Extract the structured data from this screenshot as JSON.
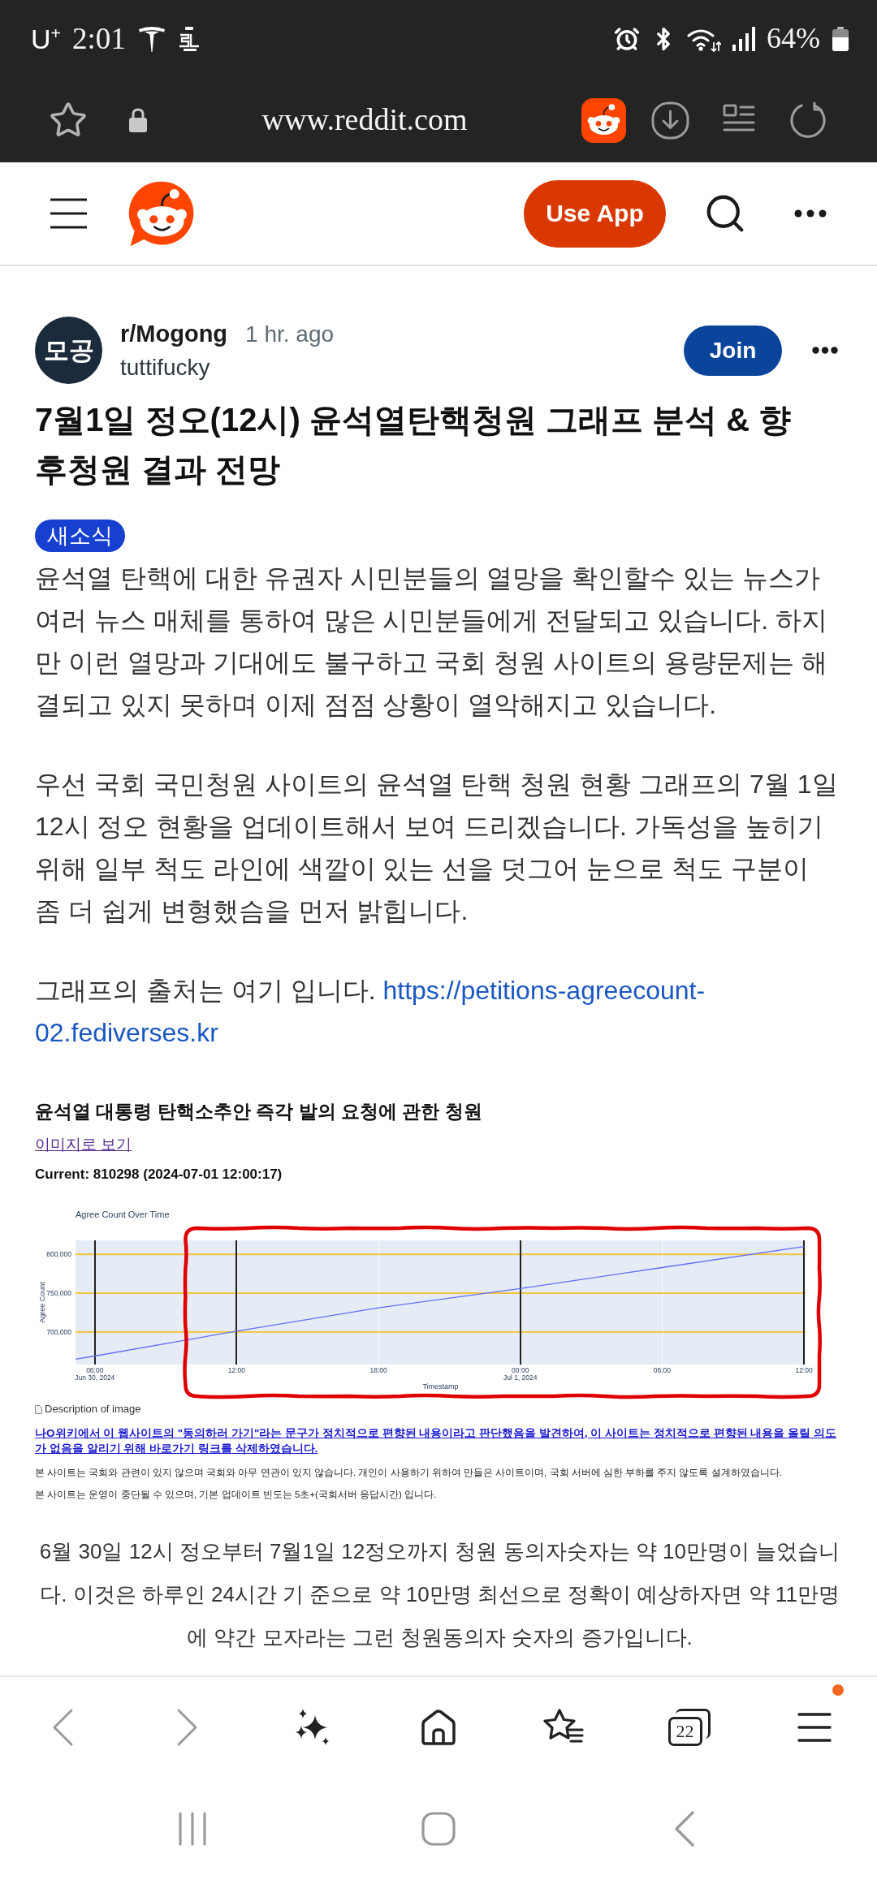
{
  "status_bar": {
    "carrier": "U$^{+}$",
    "time": "2:01",
    "battery": "64%"
  },
  "browser_bar": {
    "url": "www.reddit.com"
  },
  "site_header": {
    "use_app": "Use App"
  },
  "post": {
    "avatar": "모공",
    "subreddit": "r/Mogong",
    "age": "1 hr. ago",
    "author": "tuttifucky",
    "join": "Join",
    "title": "7월1일 정오(12시) 윤석열탄핵청원 그래프 분석 & 향후청원 결과 전망",
    "flair": "새소식",
    "paragraphs": [
      "윤석열 탄핵에 대한 유권자 시민분들의 열망을 확인할수 있는 뉴스가 여러 뉴스 매체를 통하여 많은 시민분들에게 전달되고 있습니다. 하지만 이런 열망과 기대에도 불구하고 국회 청원 사이트의 용량문제는 해결되고 있지 못하며 이제 점점 상황이 열악해지고 있습니다.",
      "우선 국회 국민청원 사이트의 윤석열 탄핵 청원 현황 그래프의 7월 1일 12시 정오 현황을 업데이트해서 보여 드리겠습니다. 가독성을 높히기 위해 일부 척도 라인에 색깔이 있는 선을 덧그어 눈으로 척도 구분이 좀 더 쉽게 변형했슴을 먼저 밝힙니다."
    ],
    "source": {
      "text": "그래프의 출처는 여기 입니다.",
      "link_lines": [
        "https://petitions-agreecount-",
        "02.fediverses.kr"
      ]
    },
    "screenshot": {
      "title": "윤석열 대통령 탄핵소추안 즉각 발의 요청에 관한 청원",
      "image_link": "이미지로 보기",
      "current": "Current: 810298 (2024-07-01 12:00:17)",
      "chart_data": {
        "type": "line",
        "title": "Agree Count Over Time",
        "xlabel": "Timestamp",
        "ylabel": "Agree Count",
        "x": [
          "2024-06-30T05:11",
          "2024-06-30T06:00",
          "2024-06-30T12:00",
          "2024-06-30T18:00",
          "2024-07-01T00:00",
          "2024-07-01T06:00",
          "2024-07-01T12:00"
        ],
        "series": [
          {
            "color": "#636efa",
            "values": [
              665000,
              669000,
              701000,
              731000,
              756000,
              783000,
              810000
            ]
          }
        ],
        "xlim": [
          "2024-06-30T05:11",
          "2024-07-01T12:04"
        ],
        "ylim": [
          658000,
          818000
        ],
        "xticks": [
          {
            "value": "2024-06-30T06:00",
            "label": "06:00\nJun 30, 2024"
          },
          {
            "value": "2024-06-30T12:00",
            "label": "12:00"
          },
          {
            "value": "2024-06-30T18:00",
            "label": "18:00"
          },
          {
            "value": "2024-07-01T00:00",
            "label": "00:00\nJul 1, 2024"
          },
          {
            "value": "2024-07-01T06:00",
            "label": "06:00"
          },
          {
            "value": "2024-07-01T12:00",
            "label": "12:00"
          }
        ],
        "yticks": [
          {
            "value": 700000,
            "label": "700,000"
          },
          {
            "value": 750000,
            "label": "750,000"
          },
          {
            "value": 800000,
            "label": "800,000"
          }
        ],
        "grid": true,
        "ref_lines": [
          {
            "axis": "y",
            "value": 700000,
            "color": "#f0c541"
          },
          {
            "axis": "y",
            "value": 750000,
            "color": "#f0c541"
          },
          {
            "axis": "y",
            "value": 800000,
            "color": "#f0c541"
          },
          {
            "axis": "x",
            "value": "2024-06-30T06:00",
            "color": "#222222"
          },
          {
            "axis": "x",
            "value": "2024-06-30T12:00",
            "color": "#222222"
          },
          {
            "axis": "x",
            "value": "2024-07-01T00:00",
            "color": "#222222"
          },
          {
            "axis": "x",
            "value": "2024-07-01T12:00",
            "color": "#222222"
          }
        ]
      },
      "hand_drawn_outline": {
        "color": "#e00000"
      },
      "image_alt": "Description of image",
      "notice": "나O위키에서 이 웹사이트의 \"동의하러 가기\"라는 문구가 정치적으로 편향된 내용이라고 판단했음을 발견하여, 이 사이트는 정치적으로 편향된 내용을 올릴 의도가 없음을 알리기 위해 바로가기 링크를 삭제하였습니다.",
      "disclaimers": [
        "본 사이트는 국회와 관련이 있지 않으며 국회와 아무 연관이 있지 않습니다. 개인이 사용하기 위하여 만들은 사이트이며, 국회 서버에 심한 부하를 주지 않도록 설계하였습니다.",
        "본 사이트는 운영이 중단될 수 있으며, 기본 업데이트 빈도는 5초+(국회서버 응답시간) 입니다."
      ]
    },
    "closing": "6월 30일 12시 정오부터 7월1일 12정오까지 청원 동의자숫자는 약 10만명이 늘었습니다. 이것은 하루인 24시간 기 준으로 약 10만명 최선으로 정확이 예상하자면 약 11만명에 약간 모자라는 그런 청원동의자 숫자의 증가입니다."
  },
  "bottom_toolbar": {
    "items": [
      {
        "kind": "back",
        "disabled": true,
        "notification": false
      },
      {
        "kind": "forward",
        "disabled": true,
        "notification": false
      },
      {
        "kind": "assistant",
        "disabled": false,
        "notification": false
      },
      {
        "kind": "home",
        "disabled": false,
        "notification": false
      },
      {
        "kind": "bookmarks",
        "disabled": false,
        "notification": false
      },
      {
        "kind": "tabs",
        "count": "22",
        "disabled": false,
        "notification": false
      },
      {
        "kind": "menu",
        "disabled": false,
        "notification": true
      }
    ]
  }
}
